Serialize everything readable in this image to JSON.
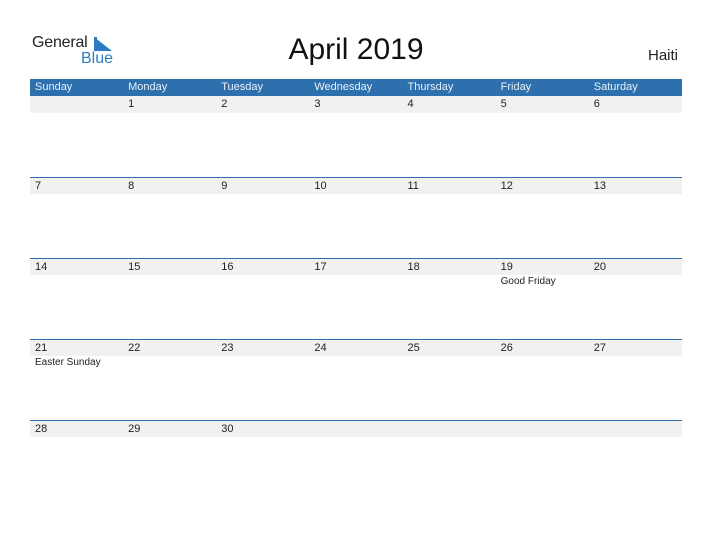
{
  "logo": {
    "general": "General",
    "blue": "Blue",
    "accent_color": "#2a7dc4"
  },
  "title": "April 2019",
  "country": "Haiti",
  "colors": {
    "header_bg": "#2e6fad",
    "row_strip": "#f1f1f1"
  },
  "weekdays": [
    "Sunday",
    "Monday",
    "Tuesday",
    "Wednesday",
    "Thursday",
    "Friday",
    "Saturday"
  ],
  "weeks": [
    [
      {
        "day": ""
      },
      {
        "day": "1"
      },
      {
        "day": "2"
      },
      {
        "day": "3"
      },
      {
        "day": "4"
      },
      {
        "day": "5"
      },
      {
        "day": "6"
      }
    ],
    [
      {
        "day": "7"
      },
      {
        "day": "8"
      },
      {
        "day": "9"
      },
      {
        "day": "10"
      },
      {
        "day": "11"
      },
      {
        "day": "12"
      },
      {
        "day": "13"
      }
    ],
    [
      {
        "day": "14"
      },
      {
        "day": "15"
      },
      {
        "day": "16"
      },
      {
        "day": "17"
      },
      {
        "day": "18"
      },
      {
        "day": "19",
        "holiday": "Good Friday"
      },
      {
        "day": "20"
      }
    ],
    [
      {
        "day": "21",
        "holiday": "Easter Sunday"
      },
      {
        "day": "22"
      },
      {
        "day": "23"
      },
      {
        "day": "24"
      },
      {
        "day": "25"
      },
      {
        "day": "26"
      },
      {
        "day": "27"
      }
    ],
    [
      {
        "day": "28"
      },
      {
        "day": "29"
      },
      {
        "day": "30"
      },
      {
        "day": ""
      },
      {
        "day": ""
      },
      {
        "day": ""
      },
      {
        "day": ""
      }
    ]
  ]
}
